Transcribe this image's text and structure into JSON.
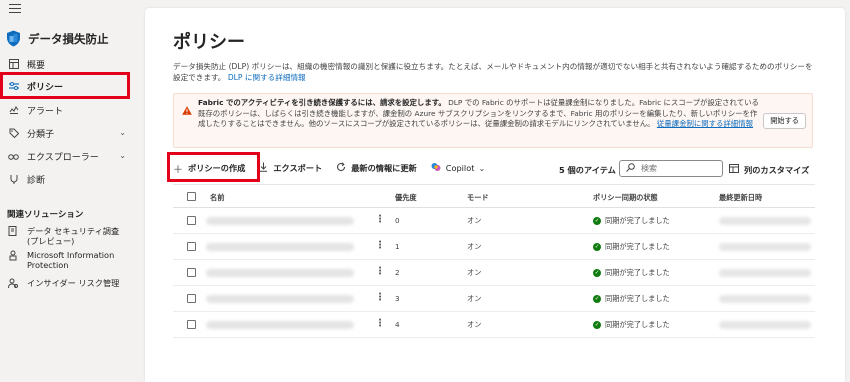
{
  "sidebar": {
    "app_title": "データ損失防止",
    "items": [
      {
        "label": "概要",
        "icon": "overview-icon"
      },
      {
        "label": "ポリシー",
        "icon": "policy-icon",
        "active": true
      },
      {
        "label": "アラート",
        "icon": "alert-icon"
      },
      {
        "label": "分類子",
        "icon": "tag-icon",
        "has_chevron": true
      },
      {
        "label": "エクスプローラー",
        "icon": "explorer-icon",
        "has_chevron": true
      },
      {
        "label": "診断",
        "icon": "diagnostics-icon"
      }
    ],
    "related_title": "関連ソリューション",
    "related": [
      {
        "label": "データ セキュリティ調査 (プレビュー)",
        "icon": "data-security-icon"
      },
      {
        "label": "Microsoft Information Protection",
        "icon": "information-protection-icon"
      },
      {
        "label": "インサイダー リスク管理",
        "icon": "insider-risk-icon"
      }
    ]
  },
  "main": {
    "title": "ポリシー",
    "description": "データ損失防止 (DLP) ポリシーは、組織の機密情報の識別と保護に役立ちます。たとえば、メールやドキュメント内の情報が適切でない相手と共有されないよう確認するためのポリシーを設定できます。",
    "description_link": "DLP に関する詳細情報",
    "warning": {
      "bold": "Fabric でのアクティビティを引き続き保護するには、請求を設定します。",
      "text": "DLP での Fabric のサポートは従量課金制になりました。Fabric にスコープが設定されている既存のポリシーは、しばらくは引き続き機能しますが、課金制の Azure サブスクリプションをリンクするまで、Fabric 用のポリシーを編集したり、新しいポリシーを作成したりすることはできません。他のソースにスコープが設定されているポリシーは、従量課金制の請求モデルにリンクされていません。",
      "link": "従量課金制に関する詳細情報",
      "button": "開始する"
    },
    "toolbar": {
      "create": "ポリシーの作成",
      "export": "エクスポート",
      "refresh": "最新の情報に更新",
      "copilot": "Copilot",
      "item_count": "5 個のアイテム",
      "search_placeholder": "検索",
      "customize": "列のカスタマイズ"
    },
    "table": {
      "columns": [
        "名前",
        "優先度",
        "モード",
        "ポリシー同期の状態",
        "最終更新日時"
      ],
      "rows": [
        {
          "priority": "0",
          "mode": "オン",
          "sync": "同期が完了しました"
        },
        {
          "priority": "1",
          "mode": "オン",
          "sync": "同期が完了しました"
        },
        {
          "priority": "2",
          "mode": "オン",
          "sync": "同期が完了しました"
        },
        {
          "priority": "3",
          "mode": "オン",
          "sync": "同期が完了しました"
        },
        {
          "priority": "4",
          "mode": "オン",
          "sync": "同期が完了しました"
        }
      ]
    }
  },
  "colors": {
    "accent": "#0f6cbd",
    "highlight": "#e3001b",
    "success": "#107c10",
    "warning": "#d83b01"
  }
}
